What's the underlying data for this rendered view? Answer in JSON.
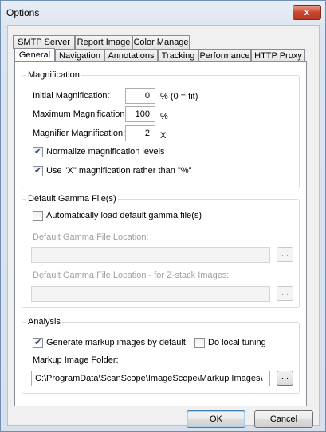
{
  "window": {
    "title": "Options",
    "close_label": "x"
  },
  "tabs": {
    "row1": [
      "SMTP Server",
      "Report Image",
      "Color Manage"
    ],
    "row2": [
      "General",
      "Navigation",
      "Annotations",
      "Tracking",
      "Performance",
      "HTTP Proxy"
    ],
    "active": "General"
  },
  "magnification": {
    "title": "Magnification",
    "initial_label": "Initial Magnification:",
    "initial_value": "0",
    "initial_unit": "% (0 = fit)",
    "maximum_label": "Maximum Magnification:",
    "maximum_value": "100",
    "maximum_unit": "%",
    "magnifier_label": "Magnifier Magnification:",
    "magnifier_value": "2",
    "magnifier_unit": "X",
    "normalize_label": "Normalize magnification levels",
    "normalize_checked": true,
    "use_x_label": "Use \"X\" magnification rather than \"%\"",
    "use_x_checked": true
  },
  "gamma": {
    "title": "Default Gamma File(s)",
    "auto_load_label": "Automatically load default gamma file(s)",
    "auto_load_checked": false,
    "location_label": "Default Gamma File Location:",
    "location_value": "",
    "zstack_label": "Default Gamma File Location - for Z-stack Images:",
    "zstack_value": "",
    "browse_label": "..."
  },
  "analysis": {
    "title": "Analysis",
    "generate_label": "Generate markup images by default",
    "generate_checked": true,
    "local_tuning_label": "Do local tuning",
    "local_tuning_checked": false,
    "folder_label": "Markup Image Folder:",
    "folder_value": "C:\\ProgramData\\ScanScope\\ImageScope\\Markup Images\\",
    "browse_label": "..."
  },
  "footer": {
    "ok_label": "OK",
    "cancel_label": "Cancel"
  }
}
